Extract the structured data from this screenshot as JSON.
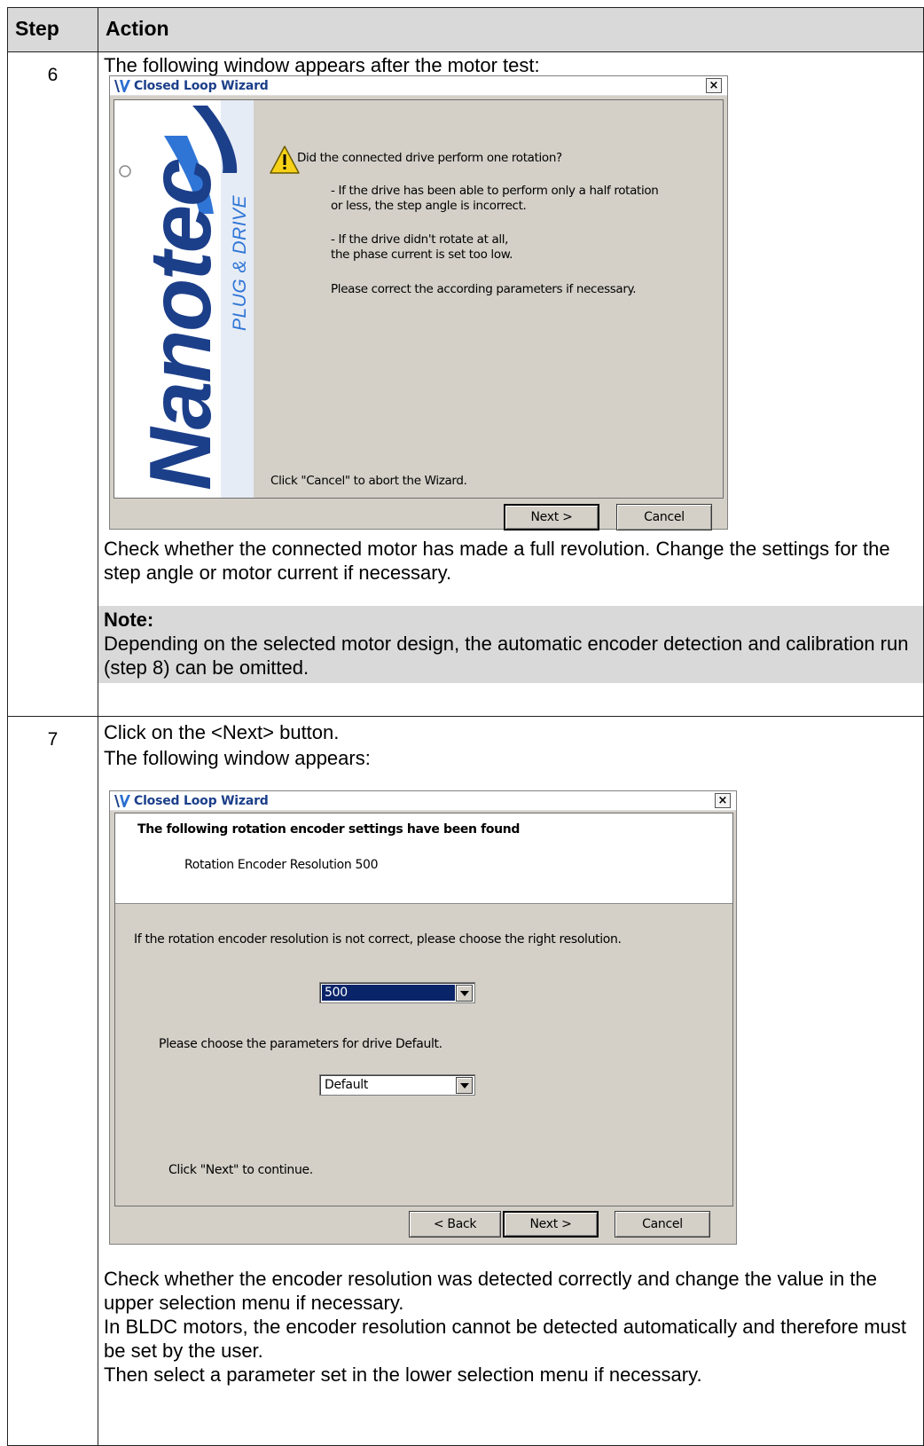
{
  "table": {
    "header_step": "Step",
    "header_action": "Action"
  },
  "row6": {
    "step": "6",
    "intro": "The following window appears after the motor test:",
    "dialog": {
      "title": "Closed Loop Wizard",
      "close_glyph": "×",
      "brand_text": "Nanotec",
      "brand_sub": "PLUG & DRIVE",
      "question": "Did the connected drive perform one rotation?",
      "line1": "- If the drive has been able to perform only a half rotation",
      "line2": "or less, the step angle is incorrect.",
      "line3": "- If the drive didn't rotate at all,",
      "line4": "the phase current is set too low.",
      "line5": "Please correct the according parameters if necessary.",
      "footer_hint": "Click  \"Cancel\" to abort the Wizard.",
      "next_label": "Next >",
      "cancel_label": "Cancel",
      "warning_icon": "warning-icon"
    },
    "body": "Check whether the connected motor has made a full revolution. Change the settings for the step angle or motor current if necessary.",
    "note_title": "Note:",
    "note_text": "Depending on the selected motor design, the automatic encoder detection and calibration run (step 8) can be omitted."
  },
  "row7": {
    "step": "7",
    "line1": "Click on the <Next> button.",
    "line2": "The following window appears:",
    "dialog": {
      "title": "Closed Loop Wizard",
      "close_glyph": "×",
      "heading": "The following rotation encoder settings have been found",
      "resolution_label": "Rotation Encoder Resolution  500",
      "instruction": "If the rotation encoder resolution is not correct, please choose the right resolution.",
      "resolution_value": "500",
      "param_label": "Please choose the parameters for drive Default.",
      "param_value": "Default",
      "footer_hint": "Click \"Next\" to continue.",
      "back_label": "< Back",
      "next_label": "Next >",
      "cancel_label": "Cancel"
    },
    "para1": "Check whether the encoder resolution was detected correctly and change the value in the upper selection menu if necessary.",
    "para2": "In BLDC motors, the encoder resolution cannot be detected automatically and therefore must be set by the user.",
    "para3": "Then select a parameter set in the lower selection menu if necessary."
  },
  "colors": {
    "dialog_bg": "#d4d0c8",
    "brand_blue": "#1c3f8a",
    "note_bg": "#d9d9d9",
    "selection_blue": "#0a246a"
  }
}
